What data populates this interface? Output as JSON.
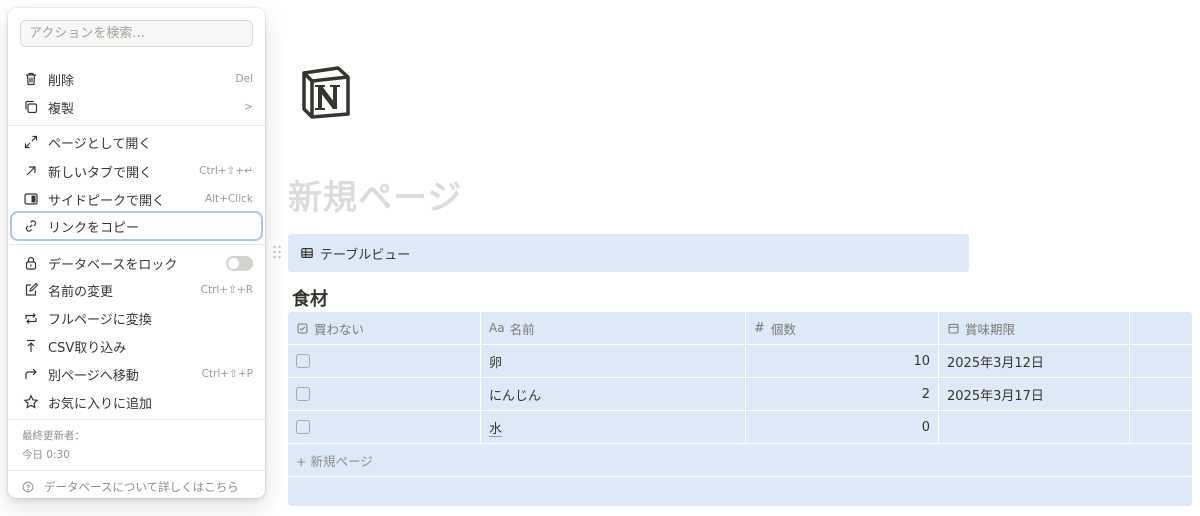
{
  "menu": {
    "search_placeholder": "アクションを検索...",
    "items": [
      {
        "label": "削除",
        "shortcut": "Del",
        "icon": "trash-icon"
      },
      {
        "label": "複製",
        "shortcut": ">",
        "icon": "duplicate-icon"
      },
      {
        "label": "ページとして開く",
        "shortcut": "",
        "icon": "expand-icon"
      },
      {
        "label": "新しいタブで開く",
        "shortcut": "Ctrl+⇧+↵",
        "icon": "arrow-up-right-icon"
      },
      {
        "label": "サイドピークで開く",
        "shortcut": "Alt+Click",
        "icon": "side-peek-icon"
      },
      {
        "label": "リンクをコピー",
        "shortcut": "",
        "icon": "link-icon"
      },
      {
        "label": "データベースをロック",
        "shortcut": "",
        "icon": "lock-icon",
        "toggle": false
      },
      {
        "label": "名前の変更",
        "shortcut": "Ctrl+⇧+R",
        "icon": "rename-icon"
      },
      {
        "label": "フルページに変換",
        "shortcut": "",
        "icon": "convert-icon"
      },
      {
        "label": "CSV取り込み",
        "shortcut": "",
        "icon": "import-icon"
      },
      {
        "label": "別ページへ移動",
        "shortcut": "Ctrl+⇧+P",
        "icon": "move-icon"
      },
      {
        "label": "お気に入りに追加",
        "shortcut": "",
        "icon": "star-icon"
      }
    ],
    "last_edited_label": "最終更新者：",
    "last_edited_time": "今日 0:30",
    "help_text": "データベースについて詳しくはこちら"
  },
  "page": {
    "title": "新規ページ",
    "view_tab": "テーブルビュー",
    "database_title": "食材",
    "columns": [
      {
        "label": "買わない",
        "icon": "checkbox-icon"
      },
      {
        "label": "名前",
        "prefix": "Aa",
        "icon": "text-icon"
      },
      {
        "label": "個数",
        "prefix": "#",
        "icon": "number-icon"
      },
      {
        "label": "賞味期限",
        "icon": "calendar-icon"
      }
    ],
    "rows": [
      {
        "checked": false,
        "name": "卵",
        "count": "10",
        "date": "2025年3月12日"
      },
      {
        "checked": false,
        "name": "にんじん",
        "count": "2",
        "date": "2025年3月17日"
      },
      {
        "checked": false,
        "name": "水",
        "count": "0",
        "date": ""
      }
    ],
    "new_row_label": "+ 新規ページ"
  },
  "colors": {
    "accent": "#a7c7ec",
    "table_bg": "#dde9f6",
    "text": "#37352f",
    "muted": "#9b9a97"
  }
}
